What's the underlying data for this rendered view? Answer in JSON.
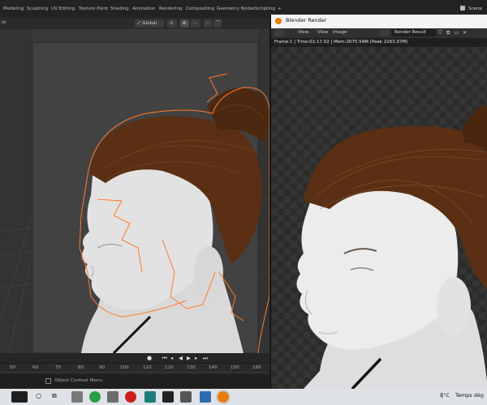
{
  "topbar": {
    "workspaces": [
      {
        "label": "Modeling",
        "active": false
      },
      {
        "label": "Sculpting",
        "active": false
      },
      {
        "label": "UV Editing",
        "active": false
      },
      {
        "label": "Texture Paint",
        "active": false
      },
      {
        "label": "Shading",
        "active": false
      },
      {
        "label": "Animation",
        "active": false
      },
      {
        "label": "Rendering",
        "active": false
      },
      {
        "label": "Compositing",
        "active": false
      },
      {
        "label": "Geometry Nodes",
        "active": false
      },
      {
        "label": "Scripting",
        "active": false
      }
    ],
    "scene_label": "Scene"
  },
  "viewport_header": {
    "left_fragment": "ct",
    "orientation": "Global"
  },
  "timeline": {
    "ticks": [
      "50",
      "60",
      "70",
      "80",
      "90",
      "100",
      "110",
      "120",
      "130",
      "140",
      "150",
      "160"
    ]
  },
  "statusbar": {
    "hint": "Object Context Menu"
  },
  "render_window": {
    "title": "Blender Render",
    "menu": [
      "View",
      "View",
      "Image"
    ],
    "slot": "Render Result",
    "info": "Frame:1 | Time:01:17.02 | Mem:2075.54M (Peak 2163.97M)"
  },
  "taskbar": {
    "temperature": "5°C",
    "weather_text": "Temps dég"
  },
  "colors": {
    "selection_outline": "#ff7a2a",
    "hair": "#5a2f14",
    "skin": "#e8e8e8",
    "active_tab": "#3b3b3b"
  }
}
